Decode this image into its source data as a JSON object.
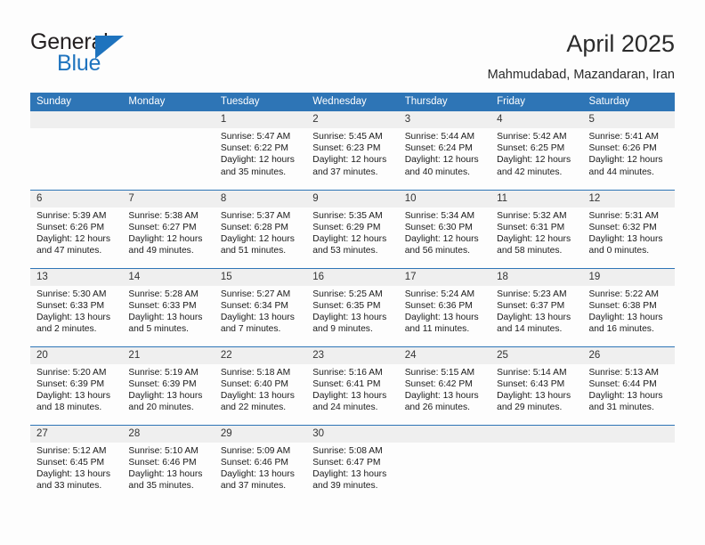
{
  "brand": {
    "name_top": "General",
    "name_bottom": "Blue",
    "triangle_color": "#1e73be"
  },
  "header": {
    "title": "April 2025",
    "subtitle": "Mahmudabad, Mazandaran, Iran"
  },
  "theme": {
    "header_blue": "#2e75b6",
    "row_divider_blue": "#2e75b6",
    "daynum_band": "#efefef",
    "page_background": "#fdfdfd",
    "text_color": "#1b1b1b"
  },
  "labels": {
    "sunrise_prefix": "Sunrise:",
    "sunset_prefix": "Sunset:",
    "daylight_prefix": "Daylight:"
  },
  "weekdays": [
    "Sunday",
    "Monday",
    "Tuesday",
    "Wednesday",
    "Thursday",
    "Friday",
    "Saturday"
  ],
  "weeks": [
    [
      {
        "day": "",
        "blank": true
      },
      {
        "day": "",
        "blank": true
      },
      {
        "day": "1",
        "sunrise": "Sunrise: 5:47 AM",
        "sunset": "Sunset: 6:22 PM",
        "daylight_line1": "Daylight: 12 hours",
        "daylight_line2": "and 35 minutes."
      },
      {
        "day": "2",
        "sunrise": "Sunrise: 5:45 AM",
        "sunset": "Sunset: 6:23 PM",
        "daylight_line1": "Daylight: 12 hours",
        "daylight_line2": "and 37 minutes."
      },
      {
        "day": "3",
        "sunrise": "Sunrise: 5:44 AM",
        "sunset": "Sunset: 6:24 PM",
        "daylight_line1": "Daylight: 12 hours",
        "daylight_line2": "and 40 minutes."
      },
      {
        "day": "4",
        "sunrise": "Sunrise: 5:42 AM",
        "sunset": "Sunset: 6:25 PM",
        "daylight_line1": "Daylight: 12 hours",
        "daylight_line2": "and 42 minutes."
      },
      {
        "day": "5",
        "sunrise": "Sunrise: 5:41 AM",
        "sunset": "Sunset: 6:26 PM",
        "daylight_line1": "Daylight: 12 hours",
        "daylight_line2": "and 44 minutes."
      }
    ],
    [
      {
        "day": "6",
        "sunrise": "Sunrise: 5:39 AM",
        "sunset": "Sunset: 6:26 PM",
        "daylight_line1": "Daylight: 12 hours",
        "daylight_line2": "and 47 minutes."
      },
      {
        "day": "7",
        "sunrise": "Sunrise: 5:38 AM",
        "sunset": "Sunset: 6:27 PM",
        "daylight_line1": "Daylight: 12 hours",
        "daylight_line2": "and 49 minutes."
      },
      {
        "day": "8",
        "sunrise": "Sunrise: 5:37 AM",
        "sunset": "Sunset: 6:28 PM",
        "daylight_line1": "Daylight: 12 hours",
        "daylight_line2": "and 51 minutes."
      },
      {
        "day": "9",
        "sunrise": "Sunrise: 5:35 AM",
        "sunset": "Sunset: 6:29 PM",
        "daylight_line1": "Daylight: 12 hours",
        "daylight_line2": "and 53 minutes."
      },
      {
        "day": "10",
        "sunrise": "Sunrise: 5:34 AM",
        "sunset": "Sunset: 6:30 PM",
        "daylight_line1": "Daylight: 12 hours",
        "daylight_line2": "and 56 minutes."
      },
      {
        "day": "11",
        "sunrise": "Sunrise: 5:32 AM",
        "sunset": "Sunset: 6:31 PM",
        "daylight_line1": "Daylight: 12 hours",
        "daylight_line2": "and 58 minutes."
      },
      {
        "day": "12",
        "sunrise": "Sunrise: 5:31 AM",
        "sunset": "Sunset: 6:32 PM",
        "daylight_line1": "Daylight: 13 hours",
        "daylight_line2": "and 0 minutes."
      }
    ],
    [
      {
        "day": "13",
        "sunrise": "Sunrise: 5:30 AM",
        "sunset": "Sunset: 6:33 PM",
        "daylight_line1": "Daylight: 13 hours",
        "daylight_line2": "and 2 minutes."
      },
      {
        "day": "14",
        "sunrise": "Sunrise: 5:28 AM",
        "sunset": "Sunset: 6:33 PM",
        "daylight_line1": "Daylight: 13 hours",
        "daylight_line2": "and 5 minutes."
      },
      {
        "day": "15",
        "sunrise": "Sunrise: 5:27 AM",
        "sunset": "Sunset: 6:34 PM",
        "daylight_line1": "Daylight: 13 hours",
        "daylight_line2": "and 7 minutes."
      },
      {
        "day": "16",
        "sunrise": "Sunrise: 5:25 AM",
        "sunset": "Sunset: 6:35 PM",
        "daylight_line1": "Daylight: 13 hours",
        "daylight_line2": "and 9 minutes."
      },
      {
        "day": "17",
        "sunrise": "Sunrise: 5:24 AM",
        "sunset": "Sunset: 6:36 PM",
        "daylight_line1": "Daylight: 13 hours",
        "daylight_line2": "and 11 minutes."
      },
      {
        "day": "18",
        "sunrise": "Sunrise: 5:23 AM",
        "sunset": "Sunset: 6:37 PM",
        "daylight_line1": "Daylight: 13 hours",
        "daylight_line2": "and 14 minutes."
      },
      {
        "day": "19",
        "sunrise": "Sunrise: 5:22 AM",
        "sunset": "Sunset: 6:38 PM",
        "daylight_line1": "Daylight: 13 hours",
        "daylight_line2": "and 16 minutes."
      }
    ],
    [
      {
        "day": "20",
        "sunrise": "Sunrise: 5:20 AM",
        "sunset": "Sunset: 6:39 PM",
        "daylight_line1": "Daylight: 13 hours",
        "daylight_line2": "and 18 minutes."
      },
      {
        "day": "21",
        "sunrise": "Sunrise: 5:19 AM",
        "sunset": "Sunset: 6:39 PM",
        "daylight_line1": "Daylight: 13 hours",
        "daylight_line2": "and 20 minutes."
      },
      {
        "day": "22",
        "sunrise": "Sunrise: 5:18 AM",
        "sunset": "Sunset: 6:40 PM",
        "daylight_line1": "Daylight: 13 hours",
        "daylight_line2": "and 22 minutes."
      },
      {
        "day": "23",
        "sunrise": "Sunrise: 5:16 AM",
        "sunset": "Sunset: 6:41 PM",
        "daylight_line1": "Daylight: 13 hours",
        "daylight_line2": "and 24 minutes."
      },
      {
        "day": "24",
        "sunrise": "Sunrise: 5:15 AM",
        "sunset": "Sunset: 6:42 PM",
        "daylight_line1": "Daylight: 13 hours",
        "daylight_line2": "and 26 minutes."
      },
      {
        "day": "25",
        "sunrise": "Sunrise: 5:14 AM",
        "sunset": "Sunset: 6:43 PM",
        "daylight_line1": "Daylight: 13 hours",
        "daylight_line2": "and 29 minutes."
      },
      {
        "day": "26",
        "sunrise": "Sunrise: 5:13 AM",
        "sunset": "Sunset: 6:44 PM",
        "daylight_line1": "Daylight: 13 hours",
        "daylight_line2": "and 31 minutes."
      }
    ],
    [
      {
        "day": "27",
        "sunrise": "Sunrise: 5:12 AM",
        "sunset": "Sunset: 6:45 PM",
        "daylight_line1": "Daylight: 13 hours",
        "daylight_line2": "and 33 minutes."
      },
      {
        "day": "28",
        "sunrise": "Sunrise: 5:10 AM",
        "sunset": "Sunset: 6:46 PM",
        "daylight_line1": "Daylight: 13 hours",
        "daylight_line2": "and 35 minutes."
      },
      {
        "day": "29",
        "sunrise": "Sunrise: 5:09 AM",
        "sunset": "Sunset: 6:46 PM",
        "daylight_line1": "Daylight: 13 hours",
        "daylight_line2": "and 37 minutes."
      },
      {
        "day": "30",
        "sunrise": "Sunrise: 5:08 AM",
        "sunset": "Sunset: 6:47 PM",
        "daylight_line1": "Daylight: 13 hours",
        "daylight_line2": "and 39 minutes."
      },
      {
        "day": "",
        "blank": true
      },
      {
        "day": "",
        "blank": true
      },
      {
        "day": "",
        "blank": true
      }
    ]
  ]
}
